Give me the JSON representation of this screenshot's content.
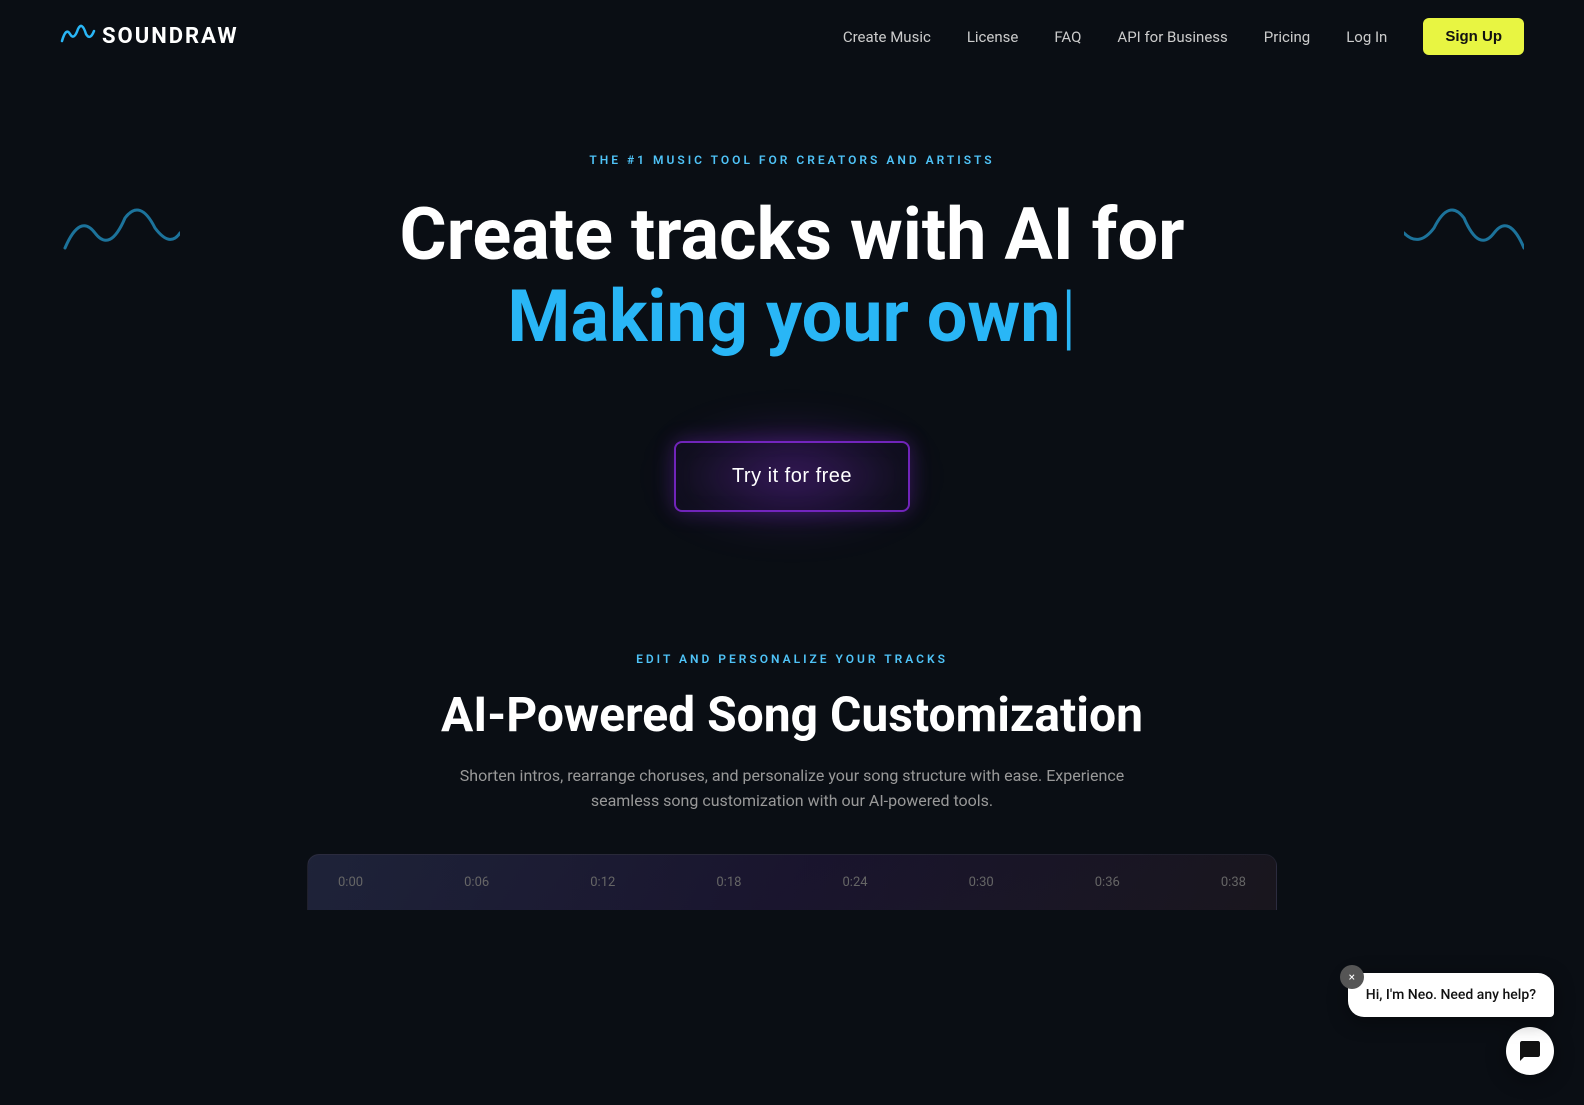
{
  "nav": {
    "logo_icon": "∿",
    "logo_text": "SOUNDRAW",
    "links": [
      {
        "id": "create-music",
        "label": "Create Music"
      },
      {
        "id": "license",
        "label": "License"
      },
      {
        "id": "faq",
        "label": "FAQ"
      },
      {
        "id": "api-for-business",
        "label": "API for Business"
      },
      {
        "id": "pricing",
        "label": "Pricing"
      },
      {
        "id": "login",
        "label": "Log In"
      }
    ],
    "signup_label": "Sign Up"
  },
  "hero": {
    "subtitle": "THE #1 MUSIC TOOL FOR CREATORS AND ARTISTS",
    "title_line1": "Create tracks with AI for",
    "title_line2": "Making your own",
    "cursor": "|",
    "cta_label": "Try it for free"
  },
  "section2": {
    "subtitle": "EDIT AND PERSONALIZE YOUR TRACKS",
    "title": "AI-Powered Song Customization",
    "description": "Shorten intros, rearrange choruses, and personalize your song structure with ease. Experience seamless song customization with our AI-powered tools.",
    "timeline_markers": [
      "0:00",
      "0:06",
      "0:12",
      "0:18",
      "0:24",
      "0:30",
      "0:36",
      "0:38"
    ]
  },
  "chat": {
    "message": "Hi, I'm Neo. Need any help?",
    "close_label": "×"
  },
  "colors": {
    "accent_blue": "#29b6f6",
    "accent_yellow": "#e8f542",
    "bg": "#0a0e14",
    "wave": "#29b6f6"
  }
}
